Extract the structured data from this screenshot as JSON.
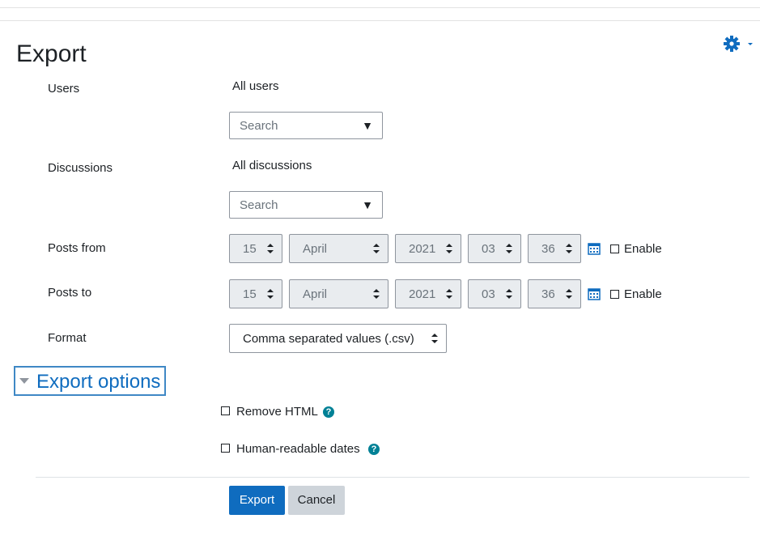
{
  "page": {
    "title": "Export"
  },
  "users": {
    "label": "Users",
    "selection": "All users",
    "placeholder": "Search"
  },
  "discussions": {
    "label": "Discussions",
    "selection": "All discussions",
    "placeholder": "Search"
  },
  "posts_from": {
    "label": "Posts from",
    "day": "15",
    "month": "April",
    "year": "2021",
    "hour": "03",
    "minute": "36",
    "enable_label": "Enable"
  },
  "posts_to": {
    "label": "Posts to",
    "day": "15",
    "month": "April",
    "year": "2021",
    "hour": "03",
    "minute": "36",
    "enable_label": "Enable"
  },
  "format": {
    "label": "Format",
    "value": "Comma separated values (.csv)"
  },
  "export_options": {
    "heading": "Export options",
    "remove_html_label": "Remove HTML",
    "human_dates_label": "Human-readable dates",
    "help_glyph": "?"
  },
  "buttons": {
    "export": "Export",
    "cancel": "Cancel"
  },
  "colors": {
    "primary": "#0f6cbf",
    "help": "#008196",
    "focus_border": "#3f88c5"
  },
  "icons": {
    "settings": "gear-icon",
    "calendar": "calendar-icon",
    "dropdown": "caret-down-icon",
    "help": "question-circle-icon"
  }
}
